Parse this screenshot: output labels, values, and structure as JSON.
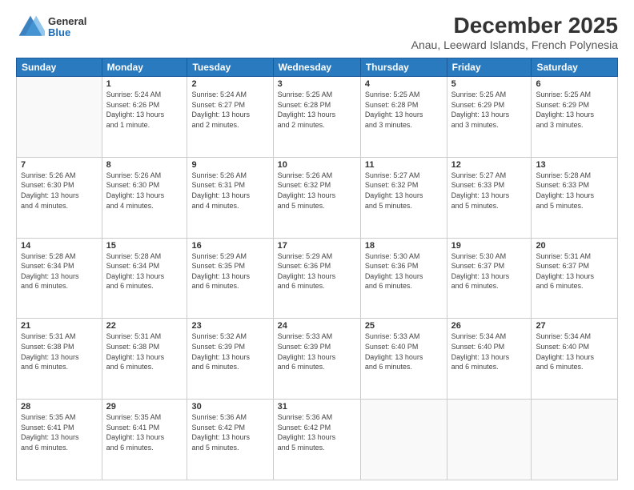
{
  "logo": {
    "general": "General",
    "blue": "Blue"
  },
  "header": {
    "month_year": "December 2025",
    "location": "Anau, Leeward Islands, French Polynesia"
  },
  "days_of_week": [
    "Sunday",
    "Monday",
    "Tuesday",
    "Wednesday",
    "Thursday",
    "Friday",
    "Saturday"
  ],
  "weeks": [
    [
      {
        "day": "",
        "info": ""
      },
      {
        "day": "1",
        "info": "Sunrise: 5:24 AM\nSunset: 6:26 PM\nDaylight: 13 hours\nand 1 minute."
      },
      {
        "day": "2",
        "info": "Sunrise: 5:24 AM\nSunset: 6:27 PM\nDaylight: 13 hours\nand 2 minutes."
      },
      {
        "day": "3",
        "info": "Sunrise: 5:25 AM\nSunset: 6:28 PM\nDaylight: 13 hours\nand 2 minutes."
      },
      {
        "day": "4",
        "info": "Sunrise: 5:25 AM\nSunset: 6:28 PM\nDaylight: 13 hours\nand 3 minutes."
      },
      {
        "day": "5",
        "info": "Sunrise: 5:25 AM\nSunset: 6:29 PM\nDaylight: 13 hours\nand 3 minutes."
      },
      {
        "day": "6",
        "info": "Sunrise: 5:25 AM\nSunset: 6:29 PM\nDaylight: 13 hours\nand 3 minutes."
      }
    ],
    [
      {
        "day": "7",
        "info": "Sunrise: 5:26 AM\nSunset: 6:30 PM\nDaylight: 13 hours\nand 4 minutes."
      },
      {
        "day": "8",
        "info": "Sunrise: 5:26 AM\nSunset: 6:30 PM\nDaylight: 13 hours\nand 4 minutes."
      },
      {
        "day": "9",
        "info": "Sunrise: 5:26 AM\nSunset: 6:31 PM\nDaylight: 13 hours\nand 4 minutes."
      },
      {
        "day": "10",
        "info": "Sunrise: 5:26 AM\nSunset: 6:32 PM\nDaylight: 13 hours\nand 5 minutes."
      },
      {
        "day": "11",
        "info": "Sunrise: 5:27 AM\nSunset: 6:32 PM\nDaylight: 13 hours\nand 5 minutes."
      },
      {
        "day": "12",
        "info": "Sunrise: 5:27 AM\nSunset: 6:33 PM\nDaylight: 13 hours\nand 5 minutes."
      },
      {
        "day": "13",
        "info": "Sunrise: 5:28 AM\nSunset: 6:33 PM\nDaylight: 13 hours\nand 5 minutes."
      }
    ],
    [
      {
        "day": "14",
        "info": "Sunrise: 5:28 AM\nSunset: 6:34 PM\nDaylight: 13 hours\nand 6 minutes."
      },
      {
        "day": "15",
        "info": "Sunrise: 5:28 AM\nSunset: 6:34 PM\nDaylight: 13 hours\nand 6 minutes."
      },
      {
        "day": "16",
        "info": "Sunrise: 5:29 AM\nSunset: 6:35 PM\nDaylight: 13 hours\nand 6 minutes."
      },
      {
        "day": "17",
        "info": "Sunrise: 5:29 AM\nSunset: 6:36 PM\nDaylight: 13 hours\nand 6 minutes."
      },
      {
        "day": "18",
        "info": "Sunrise: 5:30 AM\nSunset: 6:36 PM\nDaylight: 13 hours\nand 6 minutes."
      },
      {
        "day": "19",
        "info": "Sunrise: 5:30 AM\nSunset: 6:37 PM\nDaylight: 13 hours\nand 6 minutes."
      },
      {
        "day": "20",
        "info": "Sunrise: 5:31 AM\nSunset: 6:37 PM\nDaylight: 13 hours\nand 6 minutes."
      }
    ],
    [
      {
        "day": "21",
        "info": "Sunrise: 5:31 AM\nSunset: 6:38 PM\nDaylight: 13 hours\nand 6 minutes."
      },
      {
        "day": "22",
        "info": "Sunrise: 5:31 AM\nSunset: 6:38 PM\nDaylight: 13 hours\nand 6 minutes."
      },
      {
        "day": "23",
        "info": "Sunrise: 5:32 AM\nSunset: 6:39 PM\nDaylight: 13 hours\nand 6 minutes."
      },
      {
        "day": "24",
        "info": "Sunrise: 5:33 AM\nSunset: 6:39 PM\nDaylight: 13 hours\nand 6 minutes."
      },
      {
        "day": "25",
        "info": "Sunrise: 5:33 AM\nSunset: 6:40 PM\nDaylight: 13 hours\nand 6 minutes."
      },
      {
        "day": "26",
        "info": "Sunrise: 5:34 AM\nSunset: 6:40 PM\nDaylight: 13 hours\nand 6 minutes."
      },
      {
        "day": "27",
        "info": "Sunrise: 5:34 AM\nSunset: 6:40 PM\nDaylight: 13 hours\nand 6 minutes."
      }
    ],
    [
      {
        "day": "28",
        "info": "Sunrise: 5:35 AM\nSunset: 6:41 PM\nDaylight: 13 hours\nand 6 minutes."
      },
      {
        "day": "29",
        "info": "Sunrise: 5:35 AM\nSunset: 6:41 PM\nDaylight: 13 hours\nand 6 minutes."
      },
      {
        "day": "30",
        "info": "Sunrise: 5:36 AM\nSunset: 6:42 PM\nDaylight: 13 hours\nand 5 minutes."
      },
      {
        "day": "31",
        "info": "Sunrise: 5:36 AM\nSunset: 6:42 PM\nDaylight: 13 hours\nand 5 minutes."
      },
      {
        "day": "",
        "info": ""
      },
      {
        "day": "",
        "info": ""
      },
      {
        "day": "",
        "info": ""
      }
    ]
  ]
}
